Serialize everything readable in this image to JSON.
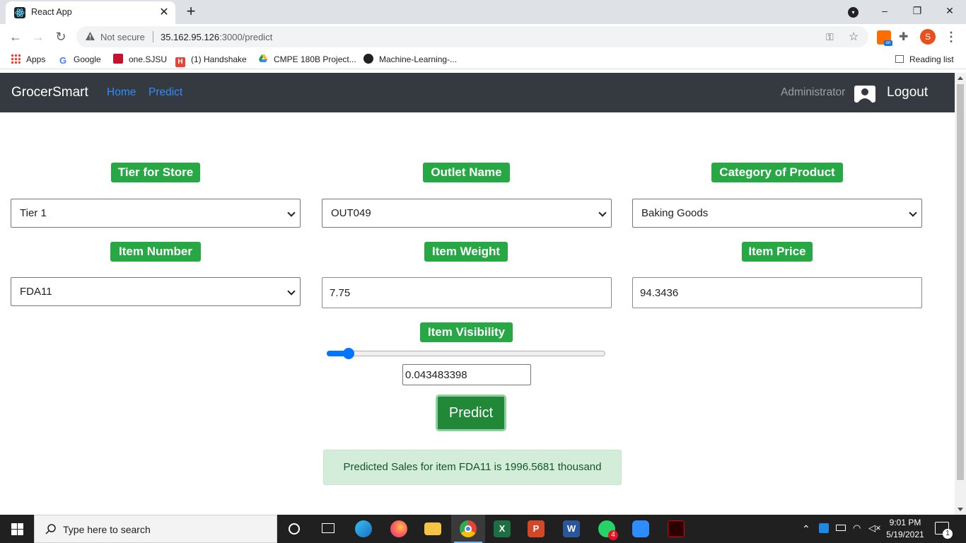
{
  "browser": {
    "tab_title": "React App",
    "tab_close": "✕",
    "new_tab": "+",
    "security_label": "Not secure",
    "url_host": "35.162.95.126",
    "url_path": ":3000/predict",
    "avatar_letter": "S",
    "window_controls": [
      "–",
      "❐",
      "✕"
    ],
    "bookmarks": [
      {
        "label": "Apps",
        "icon": "apps-grid-icon",
        "color": "#4285f4"
      },
      {
        "label": "Google",
        "icon": "google-icon",
        "color": "#4285f4"
      },
      {
        "label": "one.SJSU",
        "icon": "sjsu-icon",
        "color": "#c4122f"
      },
      {
        "label": "(1) Handshake",
        "icon": "handshake-icon",
        "color": "#e5453a"
      },
      {
        "label": "CMPE 180B Project...",
        "icon": "google-drive-icon",
        "color": "#0f9d58"
      },
      {
        "label": "Machine-Learning-...",
        "icon": "github-icon",
        "color": "#202124"
      }
    ],
    "reading_list": "Reading list"
  },
  "app": {
    "brand": "GrocerSmart",
    "nav": {
      "home": "Home",
      "predict": "Predict"
    },
    "user": "Administrator",
    "logout": "Logout",
    "colors": {
      "navbar": "#343a40",
      "label": "#28a745",
      "link": "#2f8cff",
      "button": "#218838",
      "alert_bg": "#d4edda"
    }
  },
  "form": {
    "tier_label": "Tier for Store",
    "tier_value": "Tier 1",
    "outlet_label": "Outlet Name",
    "outlet_value": "OUT049",
    "category_label": "Category of Product",
    "category_value": "Baking Goods",
    "item_number_label": "Item Number",
    "item_number_value": "FDA11",
    "weight_label": "Item Weight",
    "weight_value": "7.75",
    "price_label": "Item Price",
    "price_value": "94.3436",
    "visibility_label": "Item Visibility",
    "visibility_value": "0.043483398",
    "slider_fraction": 0.06,
    "predict_button": "Predict"
  },
  "result": {
    "message": "Predicted Sales for item FDA11 is 1996.5681 thousand"
  },
  "taskbar": {
    "search_placeholder": "Type here to search",
    "time": "9:01 PM",
    "date": "5/19/2021",
    "whatsapp_badge": "4",
    "notification_badge": "1"
  }
}
